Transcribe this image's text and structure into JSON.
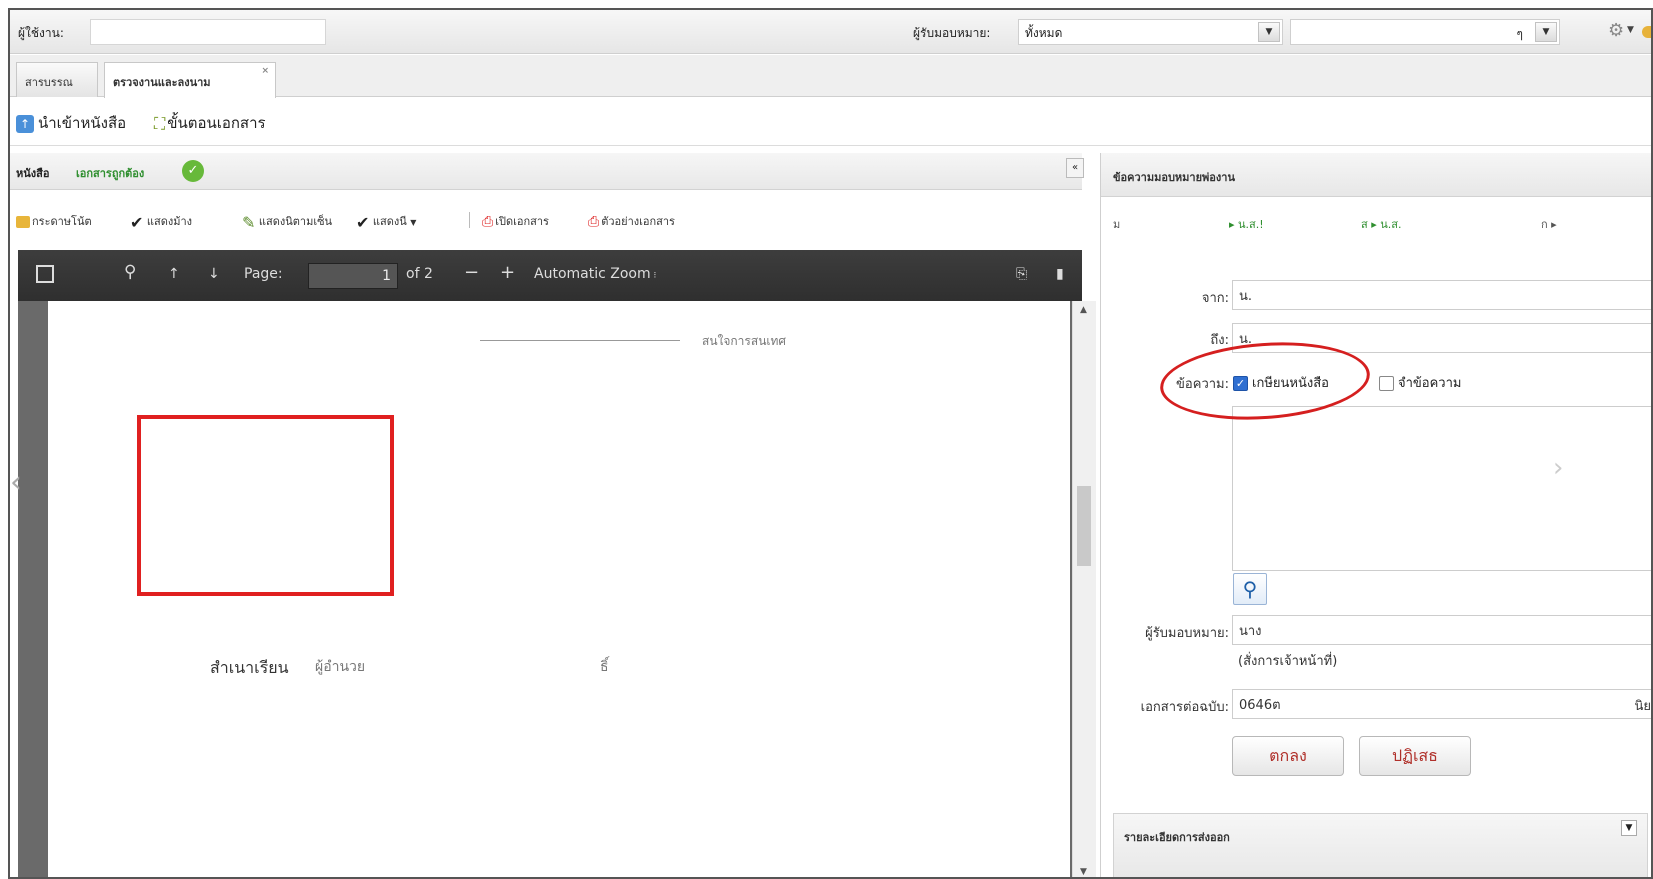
{
  "top": {
    "user_label": "ผู้ใช้งาน:",
    "recv_label": "ผู้รับมอบหมาย:",
    "recv_value": "ทั้งหมด",
    "second_value": "ๆ",
    "caret": "▼"
  },
  "tabs": [
    {
      "label": "สารบรรณ"
    },
    {
      "label": "ตรวจงานและลงนาม",
      "close": "×"
    }
  ],
  "actions": {
    "import_label": "นำเข้าหนังสือ",
    "steps_label": "ขั้นตอนเอกสาร"
  },
  "left": {
    "title": "หนังสือ",
    "status": "เอกสารถูกต้อง",
    "collapse": "«"
  },
  "doc_toolbar": {
    "paper": "กระดาษโน้ต",
    "sign": "แสดงม้าง",
    "sign_name": "แสดงนิตามเซ็น",
    "show": "แสดงนี",
    "open_doc": "เปิดเอกสาร",
    "sample_doc": "ตัวอย่างเอกสาร"
  },
  "pdf": {
    "page_label": "Page:",
    "page_value": "1",
    "page_of": "of 2",
    "zoom": "Automatic Zoom",
    "faded_top": "สนใจการสนเทศ",
    "label_1": "สำเนาเรียน",
    "label_2": "ผู้อำนวย",
    "tail": "ธิ์"
  },
  "right": {
    "title": "ข้อความมอบหมายพ่องาน",
    "route": [
      "ม",
      "▸ น.ส.!",
      "ส ▸ น.ส.",
      "ก ▸"
    ],
    "from_label": "จาก:",
    "from_value": "น.",
    "to_label": "ถึง:",
    "to_value": "น.",
    "msg_label": "ข้อความ:",
    "opt_1": "เกษียนหนังสือ",
    "opt_2": "จำข้อความ",
    "assignee_label": "ผู้รับมอบหมาย:",
    "assignee_value": "นาง",
    "assignee_note": "(สั่งการเจ้าหน้าที่)",
    "attach_label": "เอกสารต่อฉบับ:",
    "attach_value": "0646ต",
    "attach_tail": "นิย",
    "ok_button": "ตกลง",
    "reject_button": "ปฏิเสธ",
    "footer_title": "รายละเอียดการส่งออก"
  }
}
